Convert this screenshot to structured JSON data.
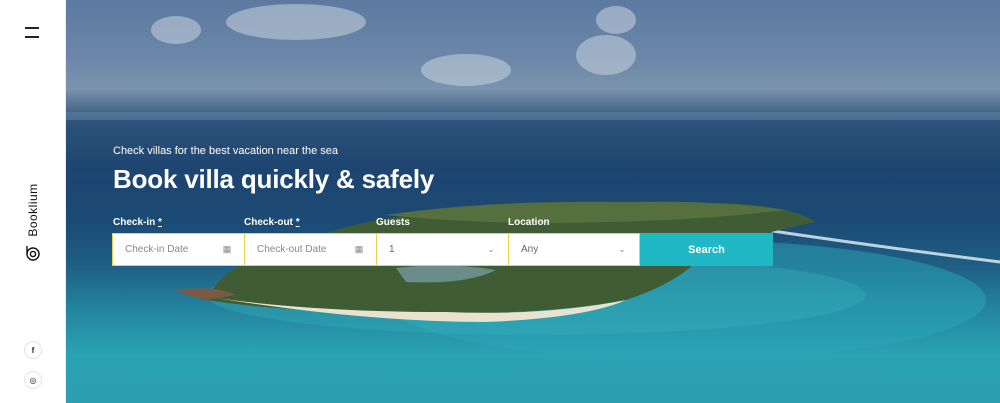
{
  "brand": {
    "name": "Booklium"
  },
  "hero": {
    "subtitle": "Check villas for the best vacation near the sea",
    "title": "Book villa quickly & safely"
  },
  "form": {
    "checkin": {
      "label": "Check-in",
      "required_mark": "*",
      "placeholder": "Check-in Date"
    },
    "checkout": {
      "label": "Check-out",
      "required_mark": "*",
      "placeholder": "Check-out Date"
    },
    "guests": {
      "label": "Guests",
      "value": "1"
    },
    "location": {
      "label": "Location",
      "value": "Any"
    },
    "search_label": "Search"
  },
  "social": [
    {
      "icon": "facebook-icon",
      "glyph": "f"
    },
    {
      "icon": "instagram-icon",
      "glyph": "◎"
    }
  ],
  "colors": {
    "accent": "#1fb8c4",
    "field_border": "#e6d34a"
  }
}
